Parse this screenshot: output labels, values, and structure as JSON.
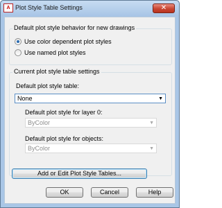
{
  "window": {
    "title": "Plot Style Table Settings",
    "app_icon_glyph": "A",
    "close_glyph": "✕"
  },
  "behavior_group": {
    "legend": "Default plot style behavior for new drawings",
    "options": [
      {
        "label": "Use color dependent plot styles",
        "checked": true
      },
      {
        "label": "Use named plot styles",
        "checked": false
      }
    ]
  },
  "settings_group": {
    "legend": "Current plot style table settings",
    "default_table_label": "Default plot style table:",
    "default_table_value": "None",
    "layer0_label": "Default plot style for layer 0:",
    "layer0_value": "ByColor",
    "objects_label": "Default plot style for objects:",
    "objects_value": "ByColor",
    "dropdown_glyph": "▼"
  },
  "buttons": {
    "add_edit": "Add or Edit Plot Style Tables...",
    "ok": "OK",
    "cancel": "Cancel",
    "help": "Help"
  }
}
